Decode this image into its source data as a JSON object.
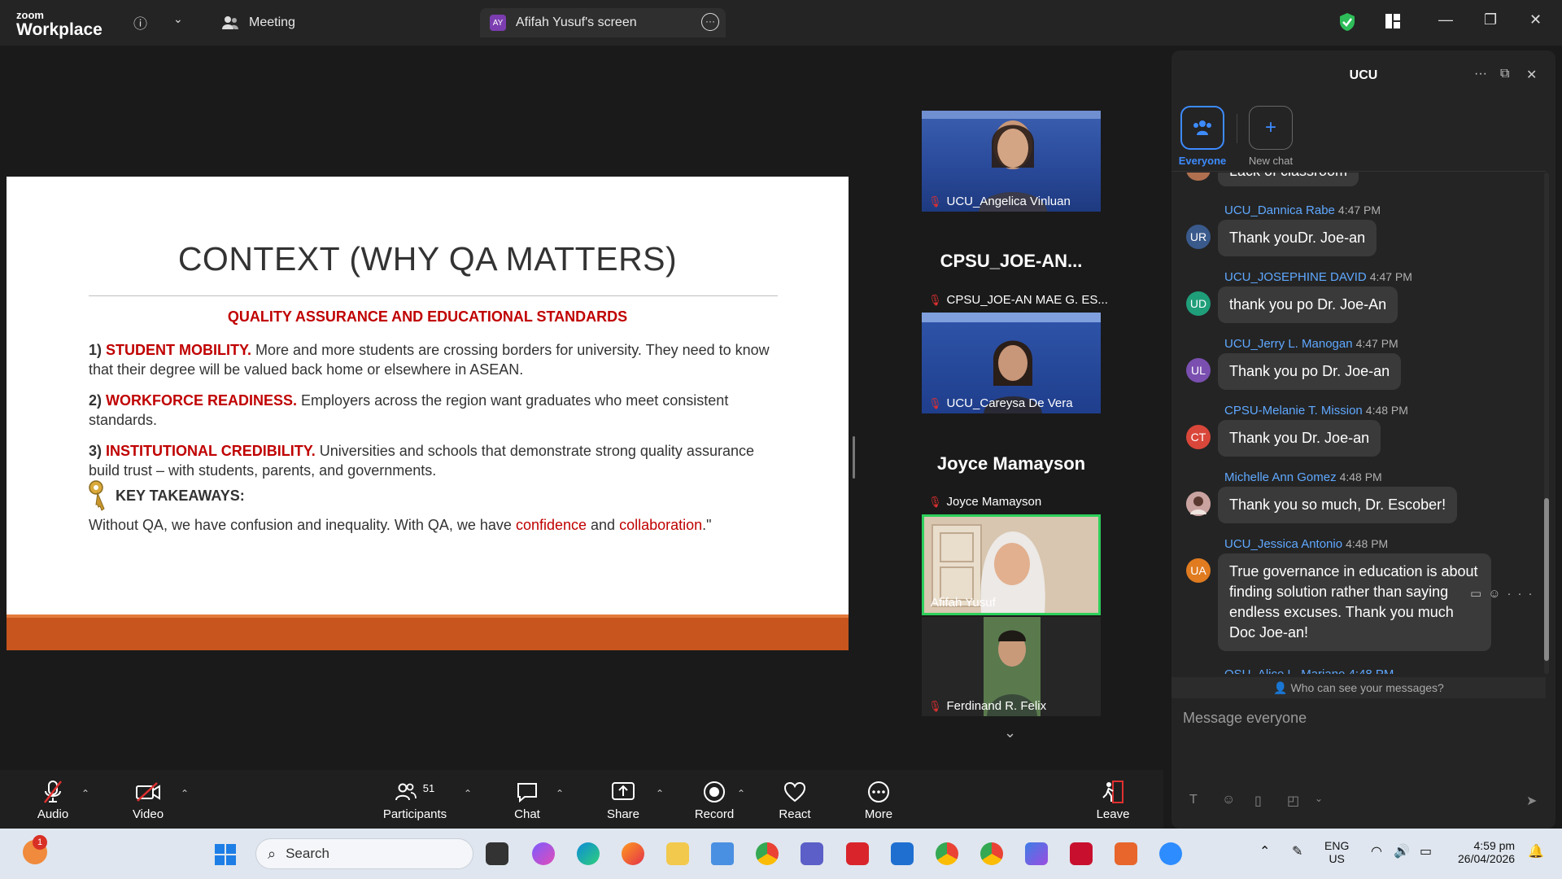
{
  "titlebar": {
    "logo_line1": "zoom",
    "logo_line2": "Workplace",
    "meeting_tab": "Meeting",
    "screen_tab": "Afifah Yusuf's screen",
    "screen_tab_avatar": "AY"
  },
  "slide": {
    "title": "CONTEXT (WHY QA MATTERS)",
    "subtitle": "QUALITY ASSURANCE AND EDUCATIONAL STANDARDS",
    "p1_num": "1)",
    "p1_head": "STUDENT MOBILITY.",
    "p1_text": " More and more students are crossing borders for university. They need to know that their degree will be valued back home or elsewhere in ASEAN.",
    "p2_num": "2)",
    "p2_head": "WORKFORCE READINESS.",
    "p2_text": " Employers across the region want graduates who meet consistent standards.",
    "p3_num": "3)",
    "p3_head": "INSTITUTIONAL CREDIBILITY.",
    "p3_text": " Universities and schools that demonstrate strong quality assurance build trust – with students, parents, and governments.",
    "key_label": "KEY TAKEAWAYS:",
    "key_text_a": "Without QA, we have confusion and inequality. With QA, we have ",
    "key_word1": "confidence",
    "key_text_b": " and ",
    "key_word2": "collaboration",
    "key_text_c": ".\""
  },
  "videos": {
    "v1_name": "UCU_Angelica Vinluan",
    "v2_label": "CPSU_JOE-AN...",
    "v2_topname": "CPSU_JOE-AN MAE G. ES...",
    "v2_name": "UCU_Careysa De Vera",
    "v3_label": "Joyce Mamayson",
    "v3_topname": "Joyce Mamayson",
    "v3_name": "Afifah Yusuf",
    "v4_name": "Ferdinand R. Felix"
  },
  "toolbar": {
    "audio": "Audio",
    "video": "Video",
    "participants": "Participants",
    "participants_count": "51",
    "chat": "Chat",
    "share": "Share",
    "record": "Record",
    "react": "React",
    "more": "More",
    "leave": "Leave"
  },
  "chat": {
    "title": "UCU",
    "everyone_label": "Everyone",
    "new_chat_label": "New chat",
    "partial_top": "Lack of classroom",
    "messages": [
      {
        "sender": "UCU_Dannica Rabe",
        "time": "4:47 PM",
        "initials": "UR",
        "color": "#3a5a8c",
        "text": "Thank youDr. Joe-an"
      },
      {
        "sender": "UCU_JOSEPHINE DAVID",
        "time": "4:47 PM",
        "initials": "UD",
        "color": "#1f9e7a",
        "text": "thank you po Dr. Joe-An"
      },
      {
        "sender": "UCU_Jerry L. Manogan",
        "time": "4:47 PM",
        "initials": "UL",
        "color": "#7a4fb0",
        "text": "Thank you po Dr. Joe-an"
      },
      {
        "sender": "CPSU-Melanie T. Mission",
        "time": "4:48 PM",
        "initials": "CT",
        "color": "#d9473a",
        "text": "Thank you Dr. Joe-an"
      },
      {
        "sender": "Michelle Ann Gomez",
        "time": "4:48 PM",
        "initials": "",
        "color": "#b08a88",
        "text": "Thank you so much, Dr. Escober!"
      },
      {
        "sender": "UCU_Jessica Antonio",
        "time": "4:48 PM",
        "initials": "UA",
        "color": "#e07b20",
        "text": "True governance in education is about finding solution rather than saying endless excuses. Thank you much Doc Joe-an!"
      }
    ],
    "partial_bottom": "OSU_Alice L. Mariano 4:48 PM",
    "who_can_see": "Who can see your messages?",
    "input_placeholder": "Message everyone"
  },
  "taskbar": {
    "search": "Search",
    "lang1": "ENG",
    "lang2": "US",
    "time": "4:59 pm",
    "date": "26/04/2026",
    "notif_badge": "1"
  }
}
